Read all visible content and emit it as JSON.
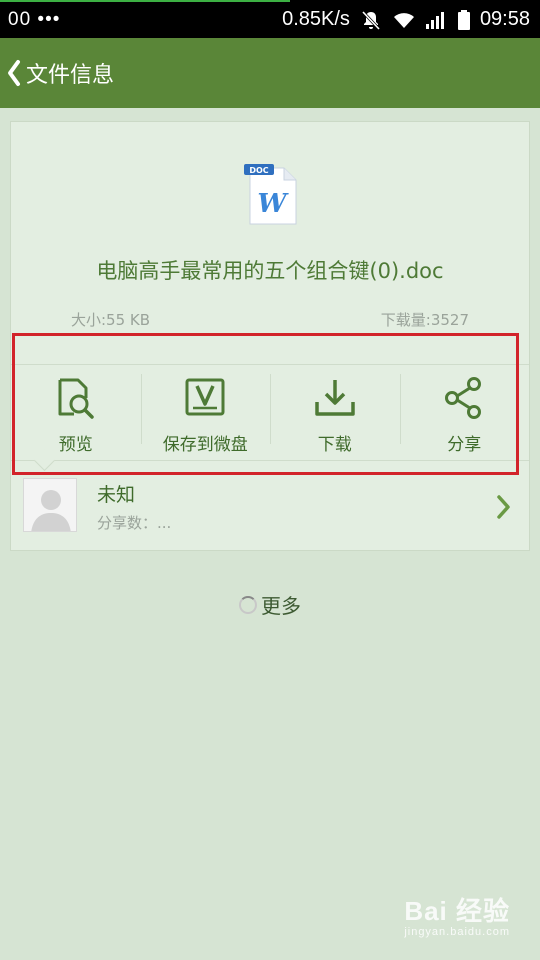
{
  "status_bar": {
    "left_text": "00 •••",
    "net_speed": "0.85K/s",
    "time": "09:58"
  },
  "app_bar": {
    "title": "文件信息",
    "back_icon": "chevron-left-icon"
  },
  "file": {
    "icon": "word-document-icon",
    "icon_badge": "DOC",
    "icon_letter": "W",
    "name": "电脑高手最常用的五个组合键(0).doc",
    "size": "大小:55 KB",
    "downloads": "下载量:3527"
  },
  "actions": [
    {
      "label": "预览",
      "icon": "preview-search-icon"
    },
    {
      "label": "保存到微盘",
      "icon": "save-to-vdisk-icon"
    },
    {
      "label": "下载",
      "icon": "download-icon"
    },
    {
      "label": "分享",
      "icon": "share-icon"
    }
  ],
  "uploader": {
    "name": "未知",
    "shares": "分享数：...",
    "avatar_icon": "default-avatar-icon",
    "chevron_icon": "chevron-right-icon"
  },
  "more_label": "更多",
  "watermark": {
    "line1": "Bai 经验",
    "line2": "jingyan.baidu.com"
  },
  "colors": {
    "app_bar": "#5a8638",
    "accent_text": "#4e7a36",
    "highlight_box": "#d2232a",
    "background": "#d6e4d3"
  }
}
